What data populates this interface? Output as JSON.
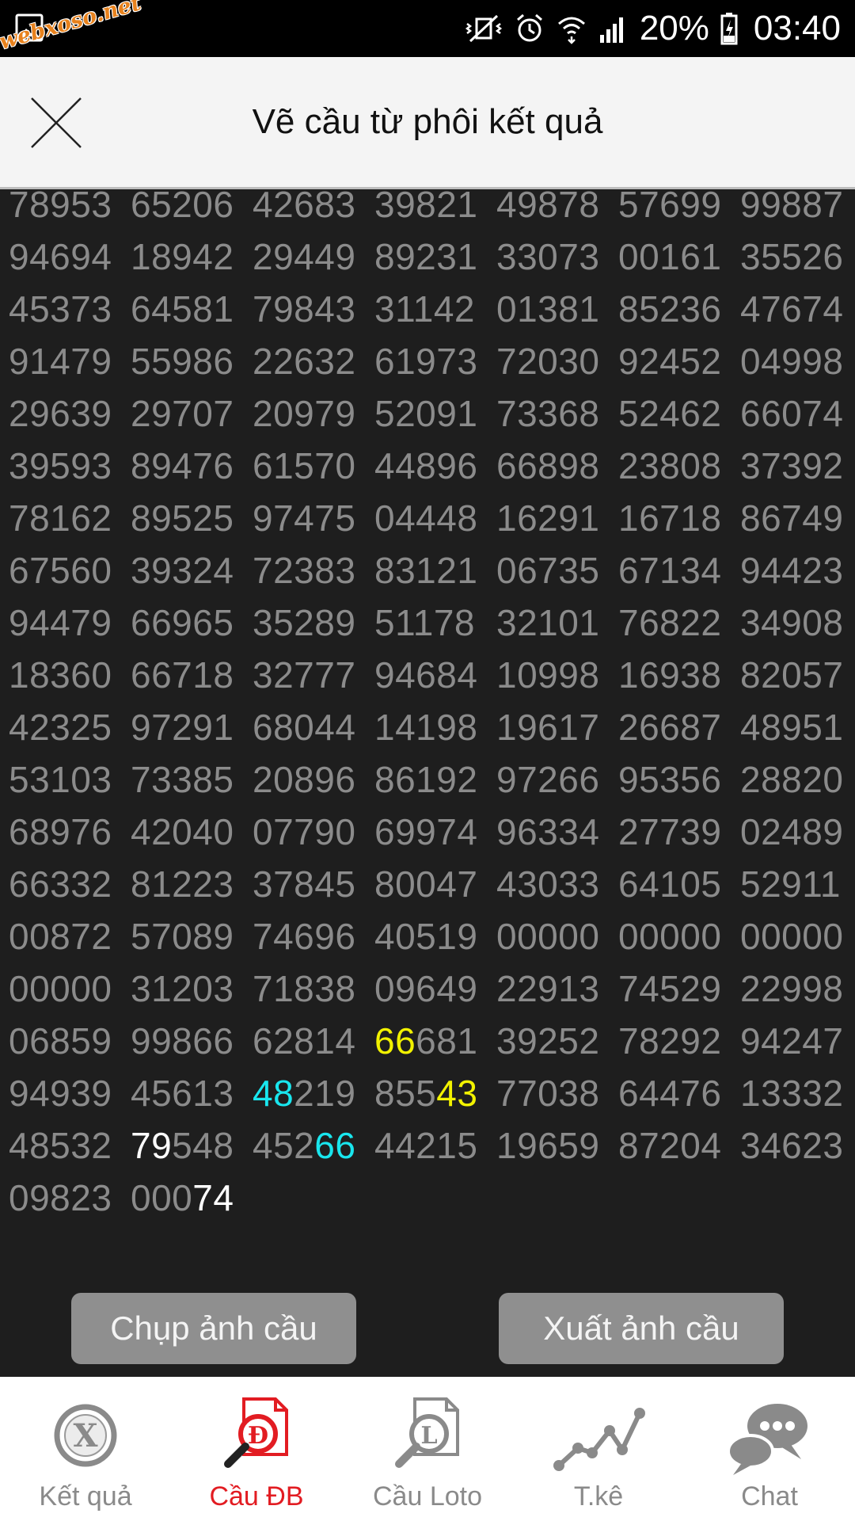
{
  "status_bar": {
    "watermark": "webxoso.net",
    "battery": "20%",
    "time": "03:40"
  },
  "header": {
    "title": "Vẽ cầu từ phôi kết quả",
    "close_icon": "close-icon"
  },
  "grid": {
    "rows": [
      [
        "78953",
        "65206",
        "42683",
        "39821",
        "49878",
        "57699",
        "99887"
      ],
      [
        "94694",
        "18942",
        "29449",
        "89231",
        "33073",
        "00161",
        "35526"
      ],
      [
        "45373",
        "64581",
        "79843",
        "31142",
        "01381",
        "85236",
        "47674"
      ],
      [
        "91479",
        "55986",
        "22632",
        "61973",
        "72030",
        "92452",
        "04998"
      ],
      [
        "29639",
        "29707",
        "20979",
        "52091",
        "73368",
        "52462",
        "66074"
      ],
      [
        "39593",
        "89476",
        "61570",
        "44896",
        "66898",
        "23808",
        "37392"
      ],
      [
        "78162",
        "89525",
        "97475",
        "04448",
        "16291",
        "16718",
        "86749"
      ],
      [
        "67560",
        "39324",
        "72383",
        "83121",
        "06735",
        "67134",
        "94423"
      ],
      [
        "94479",
        "66965",
        "35289",
        "51178",
        "32101",
        "76822",
        "34908"
      ],
      [
        "18360",
        "66718",
        "32777",
        "94684",
        "10998",
        "16938",
        "82057"
      ],
      [
        "42325",
        "97291",
        "68044",
        "14198",
        "19617",
        "26687",
        "48951"
      ],
      [
        "53103",
        "73385",
        "20896",
        "86192",
        "97266",
        "95356",
        "28820"
      ],
      [
        "68976",
        "42040",
        "07790",
        "69974",
        "96334",
        "27739",
        "02489"
      ],
      [
        "66332",
        "81223",
        "37845",
        "80047",
        "43033",
        "64105",
        "52911"
      ],
      [
        "00872",
        "57089",
        "74696",
        "40519",
        "00000",
        "00000",
        "00000"
      ],
      [
        "00000",
        "31203",
        "71838",
        "09649",
        "22913",
        "74529",
        "22998"
      ],
      [
        "06859",
        "99866",
        "62814",
        "66681",
        "39252",
        "78292",
        "94247"
      ],
      [
        "94939",
        "45613",
        "48219",
        "85543",
        "77038",
        "64476",
        "13332"
      ],
      [
        "48532",
        "79548",
        "45266",
        "44215",
        "19659",
        "87204",
        "34623"
      ],
      [
        "09823",
        "00074"
      ]
    ],
    "highlights": [
      {
        "row": 16,
        "col": 3,
        "start": 0,
        "len": 2,
        "color": "yellow"
      },
      {
        "row": 17,
        "col": 2,
        "start": 0,
        "len": 2,
        "color": "cyan"
      },
      {
        "row": 17,
        "col": 3,
        "start": 3,
        "len": 2,
        "color": "yellow"
      },
      {
        "row": 18,
        "col": 1,
        "start": 0,
        "len": 2,
        "color": "white"
      },
      {
        "row": 18,
        "col": 2,
        "start": 3,
        "len": 2,
        "color": "cyan"
      },
      {
        "row": 19,
        "col": 1,
        "start": 3,
        "len": 2,
        "color": "white"
      }
    ]
  },
  "actions": {
    "capture_label": "Chụp ảnh cầu",
    "export_label": "Xuất ảnh cầu"
  },
  "bottom_nav": {
    "items": [
      {
        "label": "Kết quả",
        "icon": "result-x-icon",
        "active": false
      },
      {
        "label": "Cầu ĐB",
        "icon": "search-d-document-icon",
        "active": true
      },
      {
        "label": "Cầu Loto",
        "icon": "search-l-document-icon",
        "active": false
      },
      {
        "label": "T.kê",
        "icon": "line-chart-icon",
        "active": false
      },
      {
        "label": "Chat",
        "icon": "chat-bubbles-icon",
        "active": false
      }
    ]
  },
  "colors": {
    "background": "#1e1e1e",
    "number_text": "#8b8b8b",
    "highlight_yellow": "#f2f200",
    "highlight_cyan": "#19e6ee",
    "highlight_white": "#ffffff",
    "active_nav": "#e21c22",
    "button_bg": "#8f8f8f"
  }
}
